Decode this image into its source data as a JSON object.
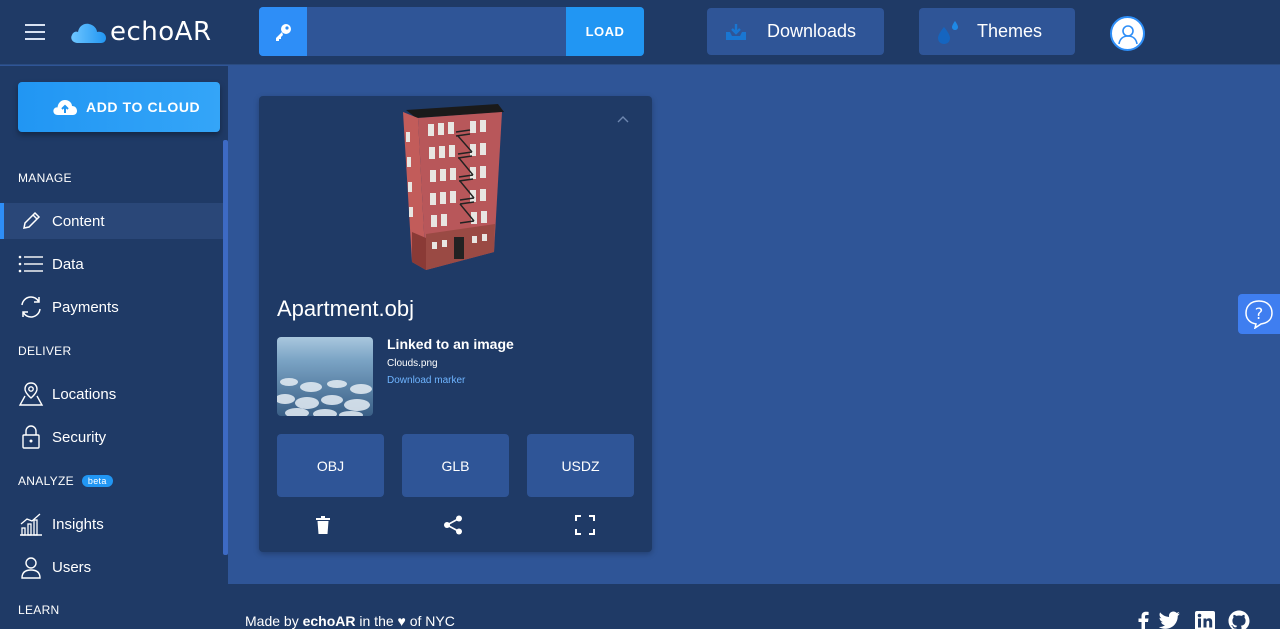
{
  "app": {
    "logo_text": "echoAR",
    "load_label": "LOAD",
    "key_value": ""
  },
  "header": {
    "downloads_label": "Downloads",
    "themes_label": "Themes"
  },
  "sidebar": {
    "add_to_cloud_label": "ADD TO CLOUD",
    "sections": {
      "manage": "MANAGE",
      "deliver": "DELIVER",
      "analyze": "ANALYZE",
      "analyze_badge": "beta",
      "learn": "LEARN"
    },
    "items": {
      "content": "Content",
      "data": "Data",
      "payments": "Payments",
      "locations": "Locations",
      "security": "Security",
      "insights": "Insights",
      "users": "Users"
    },
    "active_item": "Content"
  },
  "card": {
    "model_name": "Apartment.obj",
    "linked_title": "Linked to an image",
    "linked_file": "Clouds.png",
    "download_marker": "Download marker",
    "formats": [
      "OBJ",
      "GLB",
      "USDZ"
    ]
  },
  "footer": {
    "prefix": "Made by",
    "brand": "echoAR",
    "mid": "in the",
    "heart": "♥",
    "suffix": "of NYC"
  },
  "colors": {
    "accent": "#2196f3",
    "background": "#2f5597",
    "panel": "#1f3a66",
    "link": "#6eb4ff"
  }
}
